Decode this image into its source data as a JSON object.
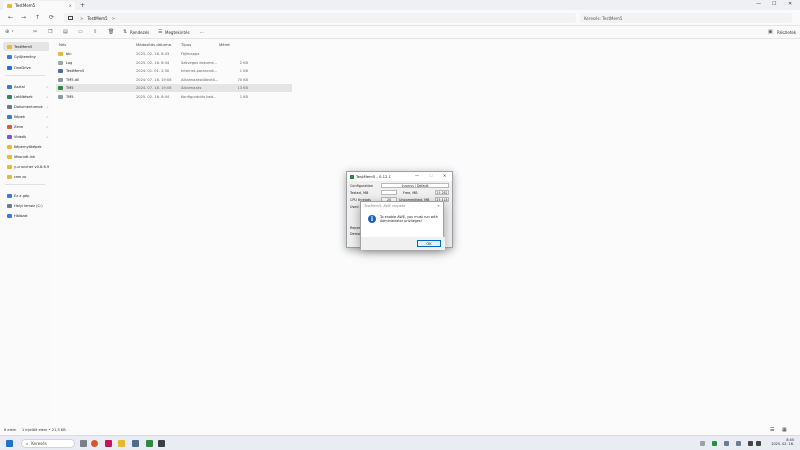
{
  "window": {
    "tab_title": "TestMem5",
    "tab_close": "×",
    "new_tab": "+",
    "minimize": "—",
    "maximize": "☐",
    "close": "✕"
  },
  "address": {
    "path_segments": [
      "TestMem5"
    ],
    "path_sep": ">",
    "search_placeholder": "Keresés: TestMem5"
  },
  "toolbar": {
    "new_label": "",
    "sort_label": "Rendezés",
    "view_label": "Megtekintés",
    "more_label": "···",
    "preview_label": "Részletek"
  },
  "sidebar": {
    "items": [
      {
        "label": "TestMem5",
        "icon": "folder-icon",
        "color": "#e8b931",
        "selected": true,
        "pin": false,
        "chev": false
      },
      {
        "label": "Gyűjtemény",
        "icon": "gallery-icon",
        "color": "#3a7bd5",
        "selected": false,
        "pin": false,
        "chev": false
      },
      {
        "label": "OneDrive",
        "icon": "cloud-icon",
        "color": "#1a73e8",
        "selected": false,
        "pin": false,
        "chev": true
      },
      {
        "label": "Asztal",
        "icon": "desktop-icon",
        "color": "#3a7bd5",
        "selected": false,
        "pin": true,
        "chev": false
      },
      {
        "label": "Letöltések",
        "icon": "download-icon",
        "color": "#2e8b57",
        "selected": false,
        "pin": true,
        "chev": false
      },
      {
        "label": "Dokumentumok",
        "icon": "document-icon",
        "color": "#6b7c93",
        "selected": false,
        "pin": true,
        "chev": false
      },
      {
        "label": "Képek",
        "icon": "pictures-icon",
        "color": "#3a7bd5",
        "selected": false,
        "pin": true,
        "chev": false
      },
      {
        "label": "Zene",
        "icon": "music-icon",
        "color": "#e0584a",
        "selected": false,
        "pin": true,
        "chev": false
      },
      {
        "label": "Videók",
        "icon": "video-icon",
        "color": "#8a4fd8",
        "selected": false,
        "pin": true,
        "chev": false
      },
      {
        "label": "Képernyőképek",
        "icon": "folder-icon",
        "color": "#e8b931",
        "selected": false,
        "pin": false,
        "chev": false
      },
      {
        "label": "lékorvát.lnk",
        "icon": "folder-icon",
        "color": "#e8b931",
        "selected": false,
        "pin": false,
        "chev": false
      },
      {
        "label": "y-cruncher v0.8.6.9",
        "icon": "folder-icon",
        "color": "#e8b931",
        "selected": false,
        "pin": false,
        "chev": false
      },
      {
        "label": "ram oc",
        "icon": "folder-icon",
        "color": "#e8b931",
        "selected": false,
        "pin": false,
        "chev": false
      },
      {
        "label": "Ez a gép",
        "icon": "pc-icon",
        "color": "#3a7bd5",
        "selected": false,
        "pin": false,
        "chev": true
      },
      {
        "label": "Helyi lemez (C:)",
        "icon": "drive-icon",
        "color": "#6b7c93",
        "selected": false,
        "pin": false,
        "chev": true
      },
      {
        "label": "Hálózat",
        "icon": "network-icon",
        "color": "#3a7bd5",
        "selected": false,
        "pin": false,
        "chev": true
      }
    ]
  },
  "columns": {
    "name": "Név",
    "modified": "Módosítás dátuma",
    "type": "Típus",
    "size": "Méret"
  },
  "files": [
    {
      "name": "bin",
      "modified": "2025. 02. 16. 8:43",
      "type": "Fájlmappa",
      "size": "",
      "icon": "folder-icon",
      "color": "#e8b931",
      "selected": false
    },
    {
      "name": "Log",
      "modified": "2025. 02. 16. 8:44",
      "type": "Szöveges dokume...",
      "size": "2 KB",
      "icon": "text-file-icon",
      "color": "#9aa5b1",
      "selected": false
    },
    {
      "name": "TestMem5",
      "modified": "2024. 01. 01. 2:30",
      "type": "Internet-parancsik...",
      "size": "1 KB",
      "icon": "shortcut-icon",
      "color": "#4a6fa5",
      "selected": false
    },
    {
      "name": "TM5.dll",
      "modified": "2024. 07. 18. 19:08",
      "type": "Alkalmazásbőbvítő...",
      "size": "70 KB",
      "icon": "dll-icon",
      "color": "#8d99a6",
      "selected": false
    },
    {
      "name": "TM5",
      "modified": "2024. 07. 18. 19:08",
      "type": "Alkalmazás",
      "size": "13 KB",
      "icon": "app-icon",
      "color": "#2d8a3e",
      "selected": true
    },
    {
      "name": "TM5",
      "modified": "2025. 02. 16. 8:44",
      "type": "Konfigurációs beá...",
      "size": "1 KB",
      "icon": "config-icon",
      "color": "#8d99a6",
      "selected": false
    }
  ],
  "status": {
    "count": "6 elem",
    "selection": "1 kijelölt elem • 21,5 KB"
  },
  "taskbar": {
    "search_label": "Keresés",
    "time": "8:45",
    "date": "2025. 02. 16."
  },
  "tm5": {
    "title": "TestMem5 - 0.12.1",
    "minimize": "—",
    "maximize": "☐",
    "close": "✕",
    "config_label": "Configuration",
    "config_value": "1usmus / Default",
    "tested_label": "Tested, MB",
    "free_label": "Free, MB",
    "free_value": "25 282",
    "cpu_label": "CPU threads",
    "cpu_value": "20",
    "uncommitted_label": "Uncommitted, MB",
    "uncommitted_value": "25 418",
    "used_label": "Used R",
    "row5_label": "Repea",
    "row6_label": "Dema"
  },
  "msgbox": {
    "title": "TestMem5: AWE request",
    "close": "✕",
    "text": "To enable AWE, you must run with Administrator privileges!",
    "ok_label": "OK"
  },
  "colors": {
    "accent": "#0067c0",
    "selection": "#e5e5e5",
    "folder": "#e8b931"
  }
}
